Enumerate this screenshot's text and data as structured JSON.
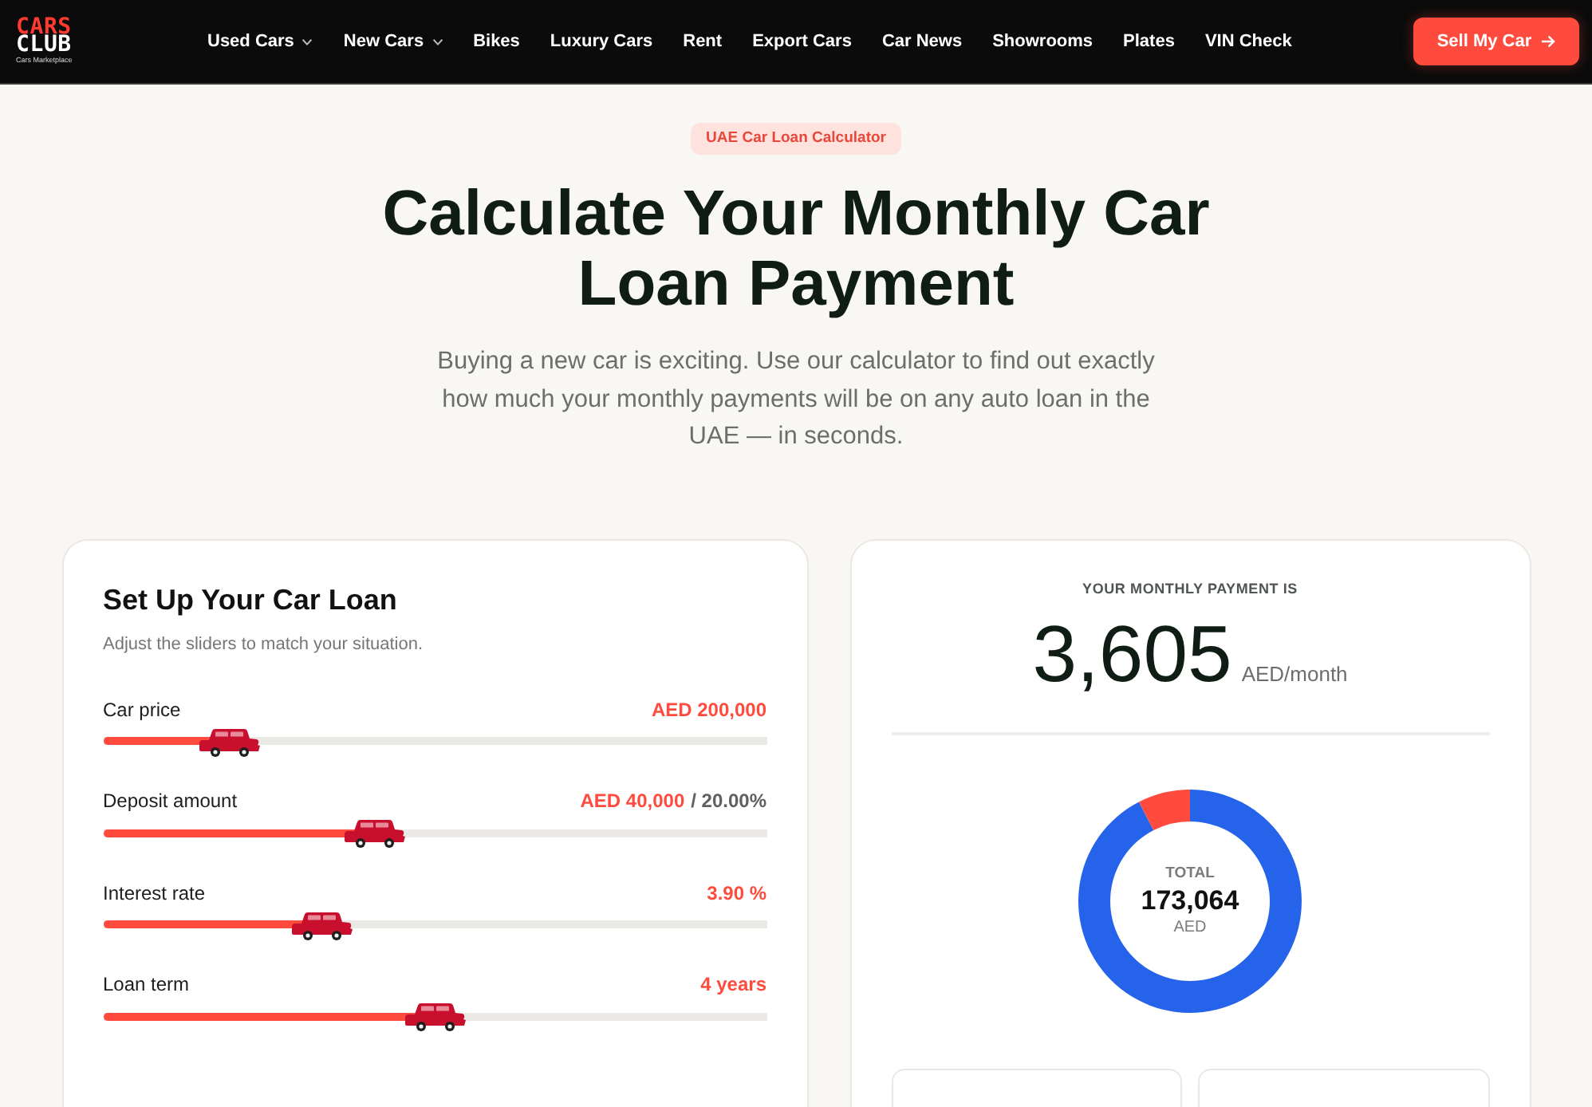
{
  "header": {
    "logo": {
      "top": "CARS",
      "bottom": "CLUB",
      "tagline": "Cars Marketplace"
    },
    "nav": [
      {
        "label": "Used Cars",
        "dropdown": true
      },
      {
        "label": "New Cars",
        "dropdown": true
      },
      {
        "label": "Bikes",
        "dropdown": false
      },
      {
        "label": "Luxury Cars",
        "dropdown": false
      },
      {
        "label": "Rent",
        "dropdown": false
      },
      {
        "label": "Export Cars",
        "dropdown": false
      },
      {
        "label": "Car News",
        "dropdown": false
      },
      {
        "label": "Showrooms",
        "dropdown": false
      },
      {
        "label": "Plates",
        "dropdown": false
      },
      {
        "label": "VIN Check",
        "dropdown": false
      }
    ],
    "cta": {
      "label": "Sell My Car"
    }
  },
  "hero": {
    "badge": "UAE Car Loan Calculator",
    "title": "Calculate Your Monthly Car Loan Payment",
    "intro": "Buying a new car is exciting. Use our calculator to find out exactly how much your monthly payments will be on any auto loan in the UAE — in seconds."
  },
  "loan_setup": {
    "title": "Set Up Your Car Loan",
    "subtitle": "Adjust the sliders to match your situation.",
    "sliders": [
      {
        "label": "Car price",
        "value": "AED 200,000",
        "level": 0.19
      },
      {
        "label": "Deposit amount",
        "value": "AED 40,000",
        "note": "/ 20.00%",
        "level": 0.41
      },
      {
        "label": "Interest rate",
        "value": "3.90 %",
        "level": 0.33
      },
      {
        "label": "Loan term",
        "value": "4 years",
        "level": 0.5
      }
    ]
  },
  "result": {
    "caption": "YOUR MONTHLY PAYMENT IS",
    "amount": "3,605",
    "unit": "AED/month",
    "total": {
      "label": "TOTAL",
      "value": "173,064",
      "currency": "AED"
    }
  }
}
